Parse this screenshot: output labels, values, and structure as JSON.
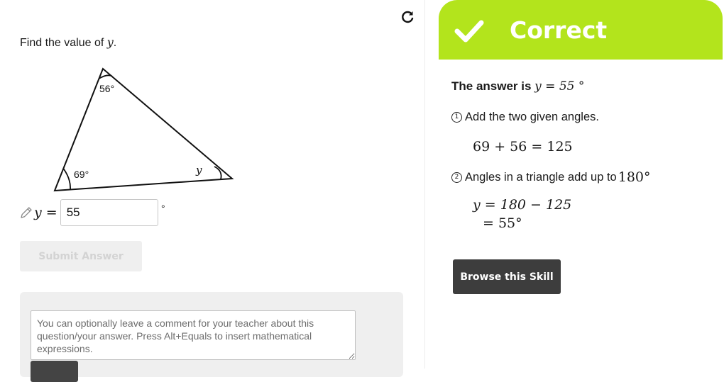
{
  "question": {
    "prompt_prefix": "Find the value of ",
    "prompt_variable": "y",
    "prompt_suffix": "."
  },
  "figure": {
    "angle_top": "56°",
    "angle_left": "69°",
    "angle_right": "y"
  },
  "answer": {
    "prefix": "y =",
    "value": "55",
    "unit": "°"
  },
  "submit": {
    "label": "Submit Answer"
  },
  "comment": {
    "placeholder": "You can optionally leave a comment for your teacher about this question/your answer. Press Alt+Equals to insert mathematical expressions.",
    "send_label": ""
  },
  "feedback": {
    "status": "Correct",
    "banner_color": "#b3e41c",
    "summary_prefix": "The answer is ",
    "summary_math": "y = 55 °",
    "step1_badge": "1",
    "step1_text": "Add the two given angles.",
    "step1_equation": "69 + 56 = 125",
    "step2_badge": "2",
    "step2_text": "Angles in a triangle add up to ",
    "step2_math": "180°",
    "step2_equation_a": "y = 180 − 125",
    "step2_equation_b": "= 55°",
    "browse_label": "Browse this Skill"
  },
  "icons": {
    "refresh": "refresh-icon",
    "pencil": "pencil-icon",
    "check": "check-icon"
  }
}
